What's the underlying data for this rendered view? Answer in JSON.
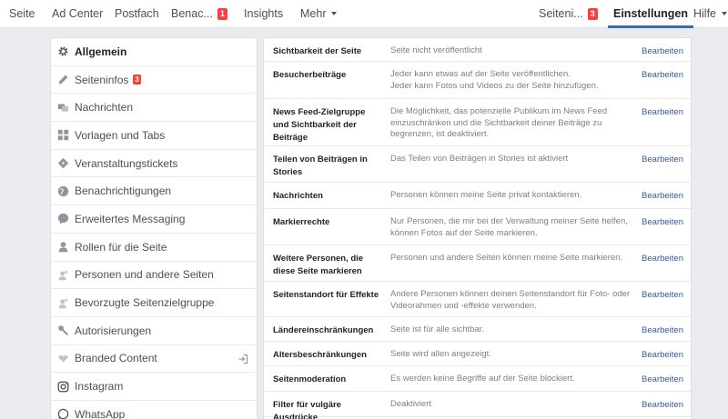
{
  "topnav": {
    "left": [
      {
        "label": "Seite"
      },
      {
        "label": "Ad Center"
      },
      {
        "label": "Postfach"
      },
      {
        "label": "Benac...",
        "badge": "1"
      },
      {
        "label": "Insights"
      },
      {
        "label": "Mehr"
      }
    ],
    "right": [
      {
        "label": "Seiteni...",
        "badge": "3"
      },
      {
        "label": "Einstellungen"
      },
      {
        "label": "Hilfe"
      }
    ]
  },
  "sidebar": {
    "items": [
      {
        "label": "Allgemein",
        "icon": "gear-icon"
      },
      {
        "label": "Seiteninfos",
        "icon": "pencil-icon",
        "badge": "3"
      },
      {
        "label": "Nachrichten",
        "icon": "chat-bubbles-icon"
      },
      {
        "label": "Vorlagen und Tabs",
        "icon": "grid-icon"
      },
      {
        "label": "Veranstaltungstickets",
        "icon": "ticket-icon"
      },
      {
        "label": "Benachrichtigungen",
        "icon": "globe-icon"
      },
      {
        "label": "Erweitertes Messaging",
        "icon": "messenger-icon"
      },
      {
        "label": "Rollen für die Seite",
        "icon": "person-icon"
      },
      {
        "label": "Personen und andere Seiten",
        "icon": "person-plus-icon"
      },
      {
        "label": "Bevorzugte Seitenzielgruppe",
        "icon": "person-plus-icon"
      },
      {
        "label": "Autorisierungen",
        "icon": "wrench-icon"
      },
      {
        "label": "Branded Content",
        "icon": "handshake-icon",
        "trailing": "login-arrow-icon"
      },
      {
        "label": "Instagram",
        "icon": "instagram-icon"
      },
      {
        "label": "WhatsApp",
        "icon": "whatsapp-icon"
      }
    ]
  },
  "settings": {
    "edit_label": "Bearbeiten",
    "rows": [
      {
        "title": "Sichtbarkeit der Seite",
        "desc": "Seite nicht veröffentlicht"
      },
      {
        "title": "Besucherbeiträge",
        "desc": "Jeder kann etwas auf der Seite veröffentlichen.\nJeder kann Fotos und Videos zu der Seite hinzufügen."
      },
      {
        "title": "News Feed-Zielgruppe und Sichtbarkeit der Beiträge",
        "desc": "Die Möglichkeit, das potenzielle Publikum im News Feed einzuschränken und die Sichtbarkeit deiner Beiträge zu begrenzen, ist deaktiviert."
      },
      {
        "title": "Teilen von Beiträgen in Stories",
        "desc": "Das Teilen von Beiträgen in Stories ist aktiviert"
      },
      {
        "title": "Nachrichten",
        "desc": "Personen können meine Seite privat kontaktieren."
      },
      {
        "title": "Markierrechte",
        "desc": "Nur Personen, die mir bei der Verwaltung meiner Seite helfen, können Fotos auf der Seite markieren."
      },
      {
        "title": "Weitere Personen, die diese Seite markieren",
        "desc": "Personen und andere Seiten können meine Seite markieren."
      },
      {
        "title": "Seitenstandort für Effekte",
        "desc": "Andere Personen können deinen Seitenstandort für Foto- oder Videorahmen und -effekte verwenden."
      },
      {
        "title": "Ländereinschränkungen",
        "desc": "Seite ist für alle sichtbar."
      },
      {
        "title": "Altersbeschränkungen",
        "desc": "Seite wird allen angezeigt."
      },
      {
        "title": "Seitenmoderation",
        "desc": "Es werden keine Begriffe auf der Seite blockiert."
      },
      {
        "title": "Filter für vulgäre Ausdrücke",
        "desc": "Deaktiviert"
      }
    ]
  }
}
